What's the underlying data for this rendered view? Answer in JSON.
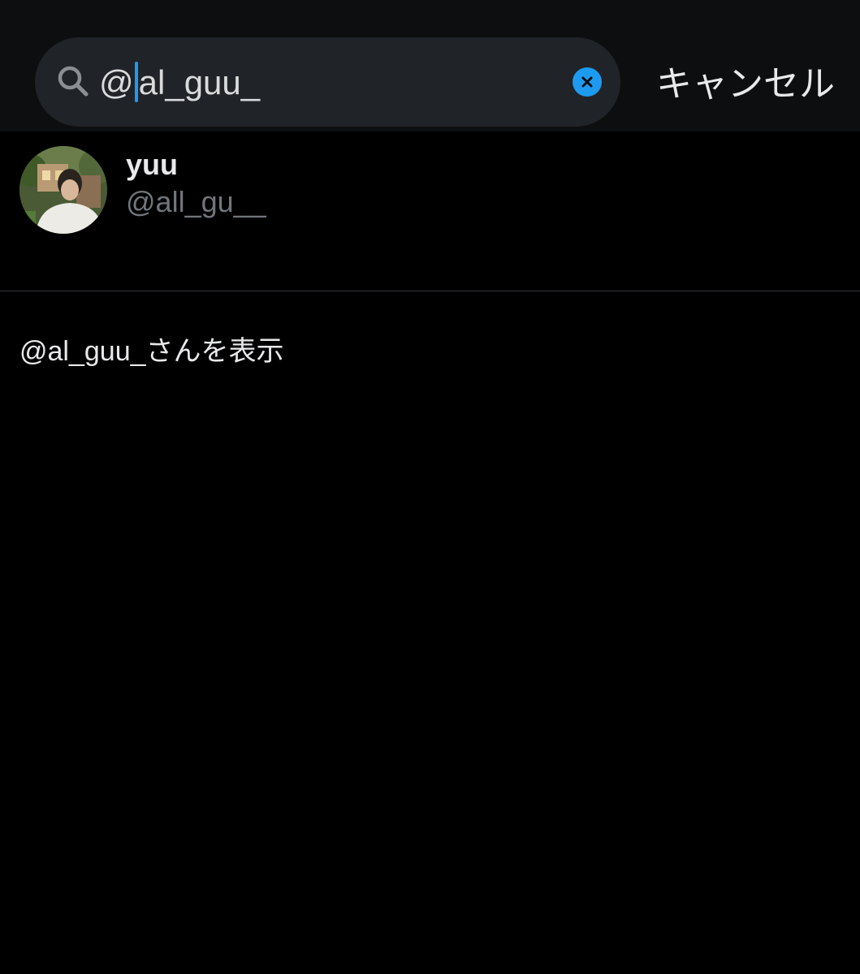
{
  "search": {
    "value_before_caret": "@",
    "value_after_caret": "al_guu_",
    "cancel_label": "キャンセル",
    "icon": "search-icon",
    "clear_icon": "clear-icon"
  },
  "results": [
    {
      "display_name": "yuu",
      "handle": "@all_gu__"
    }
  ],
  "go_to_profile_label": "@al_guu_さんを表示",
  "colors": {
    "accent": "#1d9bf0",
    "background": "#000000",
    "search_bar_bg": "#0d0e10",
    "field_bg": "#202327",
    "secondary_text": "#71767b",
    "divider": "#2f3336"
  }
}
